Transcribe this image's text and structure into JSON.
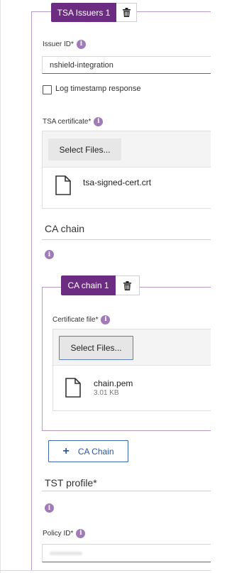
{
  "tsa_issuer_tab": {
    "label": "TSA Issuers 1"
  },
  "issuer_id": {
    "label": "Issuer ID*",
    "value": "nshield-integration"
  },
  "log_timestamp": {
    "label": "Log timestamp response",
    "checked": false
  },
  "tsa_certificate": {
    "label": "TSA certificate*",
    "select_label": "Select Files...",
    "file": {
      "name": "tsa-signed-cert.crt"
    }
  },
  "ca_chain_section": {
    "heading": "CA chain"
  },
  "ca_chain_tab": {
    "label": "CA chain 1"
  },
  "certificate_file": {
    "label": "Certificate file*",
    "select_label": "Select Files...",
    "file": {
      "name": "chain.pem",
      "size": "3.01 KB"
    }
  },
  "add_ca_chain": {
    "label": "CA Chain"
  },
  "tst_profile": {
    "heading": "TST profile*"
  },
  "policy_id": {
    "label": "Policy ID*",
    "value": ""
  },
  "icons": {
    "info": "info-icon",
    "delete": "trash-icon",
    "file": "file-icon",
    "add": "plus-icon"
  },
  "colors": {
    "accent": "#6b2c82",
    "info": "#a07bb8",
    "error_underline": "#b3472e",
    "link_blue": "#2c55a3"
  }
}
